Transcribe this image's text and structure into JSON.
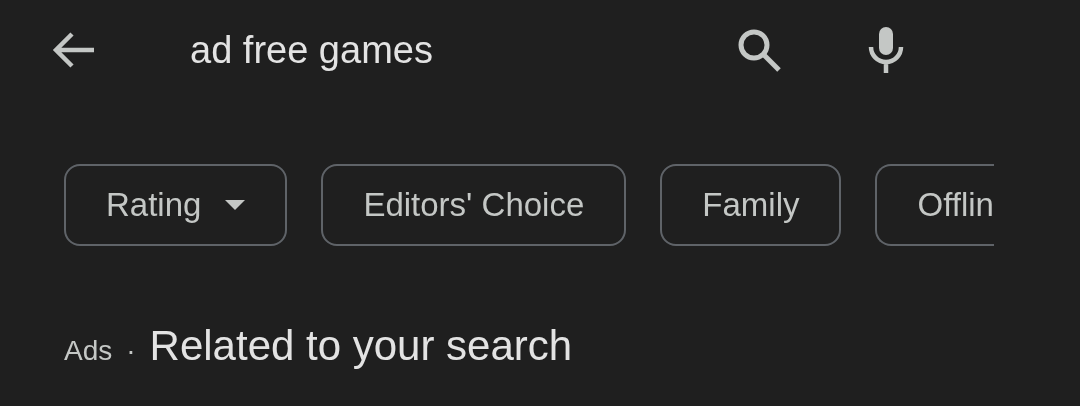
{
  "search_bar": {
    "query": "ad free games"
  },
  "filter_chips": [
    {
      "label": "Rating",
      "kind": "dropdown"
    },
    {
      "label": "Editors' Choice",
      "kind": "toggle"
    },
    {
      "label": "Family",
      "kind": "toggle"
    },
    {
      "label": "Offlin",
      "kind": "toggle"
    }
  ],
  "section": {
    "badge": "Ads",
    "separator": "·",
    "title": "Related to your search"
  }
}
